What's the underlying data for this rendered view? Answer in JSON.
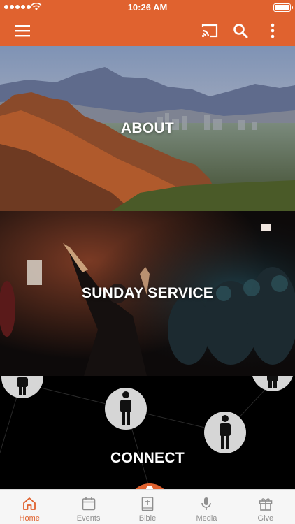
{
  "status_bar": {
    "time": "10:26 AM"
  },
  "app_bar": {
    "menu_icon": "menu-icon",
    "actions": [
      "cast-icon",
      "search-icon",
      "more-vertical-icon"
    ]
  },
  "tiles": [
    {
      "label": "ABOUT"
    },
    {
      "label": "SUNDAY SERVICE"
    },
    {
      "label": "CONNECT"
    }
  ],
  "tab_bar": {
    "active_index": 0,
    "items": [
      {
        "label": "Home",
        "icon": "home-icon"
      },
      {
        "label": "Events",
        "icon": "calendar-icon"
      },
      {
        "label": "Bible",
        "icon": "bible-icon"
      },
      {
        "label": "Media",
        "icon": "microphone-icon"
      },
      {
        "label": "Give",
        "icon": "gift-icon"
      }
    ]
  },
  "colors": {
    "accent": "#e0622f",
    "tab_inactive": "#8e8e8e",
    "tab_bar_bg": "#f6f6f6"
  }
}
